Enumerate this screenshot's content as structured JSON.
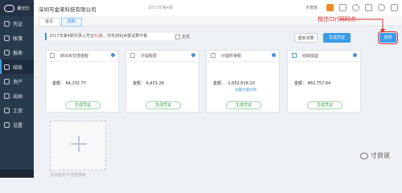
{
  "app": {
    "logo_text": "聚光灯"
  },
  "topbar": {
    "company": "深圳市金某科技有限公司",
    "period": "2017年第4期",
    "user": "大管家"
  },
  "sidebar": {
    "items": [
      {
        "label": "凭证"
      },
      {
        "label": "账簿"
      },
      {
        "label": "报表"
      },
      {
        "label": "结账"
      },
      {
        "label": "资产"
      },
      {
        "label": "出纳"
      },
      {
        "label": "工资"
      },
      {
        "label": "设置"
      }
    ]
  },
  "tabs": [
    {
      "label": "首页"
    },
    {
      "label": "结账"
    }
  ],
  "notice": {
    "prefix": "2017年第4期共录入凭证",
    "count": "42",
    "suffix": "张，财务初始余额试算平衡"
  },
  "check_all_label": "全选",
  "buttons": {
    "recalc": "重新测算",
    "generate": "生成凭证",
    "close": "结账"
  },
  "annotation": "按住Ctrl同时点",
  "cards": [
    {
      "title": "转出未交增值税",
      "amount": "金额：  64,332.77",
      "sub": "",
      "button": "生成凭证"
    },
    {
      "title": "计提税费",
      "amount": "金额：  6,433.28",
      "sub": "",
      "button": "生成凭证"
    },
    {
      "title": "计提所得税",
      "amount": "金额：  -1,602,818.10",
      "sub": "设置计提比例",
      "button": "生成凭证"
    },
    {
      "title": "结转损益",
      "amount": "金额：  482,757.64",
      "sub": "",
      "button": "生成凭证"
    }
  ],
  "add_template_label": "添加自定义凭证模板",
  "watermark": "寸良说"
}
